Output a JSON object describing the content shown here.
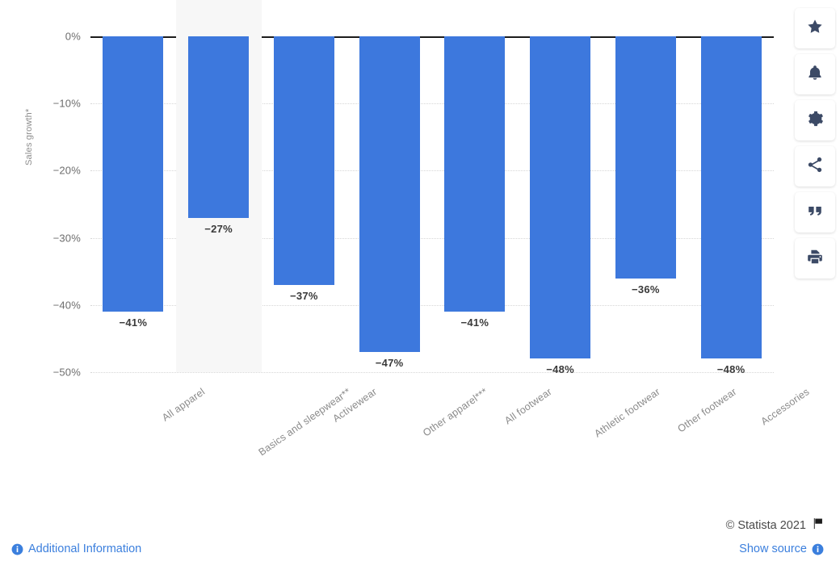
{
  "chart_data": {
    "type": "bar",
    "title": "",
    "xlabel": "",
    "ylabel": "Sales growth*",
    "ylim": [
      -50,
      0
    ],
    "grid": true,
    "legend": "none",
    "categories": [
      "All apparel",
      "Basics and sleepwear**",
      "Activewear",
      "Other apparel***",
      "All footwear",
      "Athletic footwear",
      "Other footwear",
      "Accessories"
    ],
    "values": [
      -41,
      -27,
      -37,
      -47,
      -41,
      -48,
      -36,
      -48
    ],
    "data_labels": [
      "−41%",
      "−27%",
      "−37%",
      "−47%",
      "−41%",
      "−48%",
      "−36%",
      "−48%"
    ],
    "ytick_labels": [
      "0%",
      "−10%",
      "−20%",
      "−30%",
      "−40%",
      "−50%"
    ],
    "ytick_values": [
      0,
      -10,
      -20,
      -30,
      -40,
      -50
    ],
    "bar_color": "#3d78dd",
    "highlighted_category_index": 1,
    "highlight_color": "#f7f7f7",
    "zero_line_color": "#1c1c1c",
    "gridline_color": "#d6d6d6",
    "tick_text_color": "#6d6d6d",
    "category_text_color": "#8a8a8a",
    "data_label_color": "#3a3a3a"
  },
  "toolbar": {
    "buttons": [
      {
        "name": "favorite-button",
        "icon": "star-icon"
      },
      {
        "name": "notification-button",
        "icon": "bell-icon"
      },
      {
        "name": "settings-button",
        "icon": "gear-icon"
      },
      {
        "name": "share-button",
        "icon": "share-icon"
      },
      {
        "name": "citation-button",
        "icon": "quote-icon"
      },
      {
        "name": "print-button",
        "icon": "print-icon"
      }
    ]
  },
  "footer": {
    "copyright": "© Statista 2021",
    "flag_icon": "flag-icon",
    "additional_information_label": "Additional Information",
    "additional_information_icon": "info-icon",
    "show_source_label": "Show source",
    "show_source_icon": "info-icon",
    "link_color": "#3b7fdd"
  }
}
